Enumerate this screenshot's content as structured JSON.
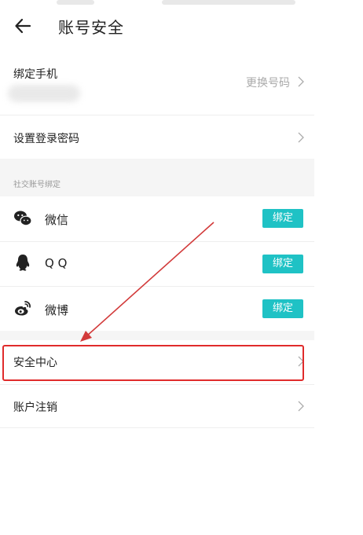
{
  "header": {
    "title": "账号安全"
  },
  "phone_row": {
    "label": "绑定手机",
    "action": "更换号码"
  },
  "password_row": {
    "label": "设置登录密码"
  },
  "social_section": {
    "title": "社交账号绑定",
    "items": [
      {
        "label": "微信",
        "button": "绑定",
        "icon": "wechat-icon"
      },
      {
        "label": "Q Q",
        "button": "绑定",
        "icon": "qq-icon"
      },
      {
        "label": "微博",
        "button": "绑定",
        "icon": "weibo-icon"
      }
    ]
  },
  "security_center_row": {
    "label": "安全中心"
  },
  "account_cancel_row": {
    "label": "账户注销"
  },
  "colors": {
    "accent": "#1fc2c5",
    "highlight": "#e02b2b",
    "section_bg": "#f5f5f5"
  }
}
